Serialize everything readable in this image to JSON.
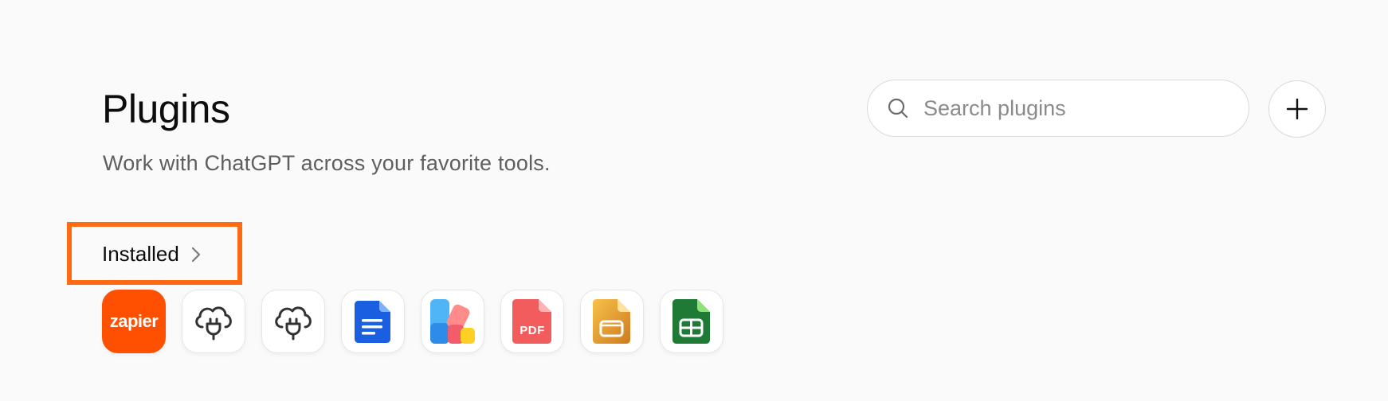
{
  "header": {
    "title": "Plugins",
    "subtitle": "Work with ChatGPT across your favorite tools."
  },
  "search": {
    "placeholder": "Search plugins",
    "value": ""
  },
  "add_button": {
    "icon": "plus-icon"
  },
  "installed": {
    "label": "Installed",
    "icon": "chevron-right-icon",
    "highlight_color": "#ff6a13"
  },
  "plugins": [
    {
      "name": "zapier",
      "text": "zapier",
      "color": "#ff4f00"
    },
    {
      "name": "cloud-plug",
      "icon": "cloud-plug-icon"
    },
    {
      "name": "cloud-plug",
      "icon": "cloud-plug-icon"
    },
    {
      "name": "docs",
      "icon": "document-icon",
      "color": "#1a73e8"
    },
    {
      "name": "canva",
      "icon": "colorful-blocks-icon"
    },
    {
      "name": "pdf",
      "text": "PDF",
      "color": "#f25c5c"
    },
    {
      "name": "slides",
      "icon": "slides-icon",
      "color": "#e9a23b"
    },
    {
      "name": "sheets",
      "icon": "sheets-icon",
      "color": "#1e8e3e"
    }
  ]
}
